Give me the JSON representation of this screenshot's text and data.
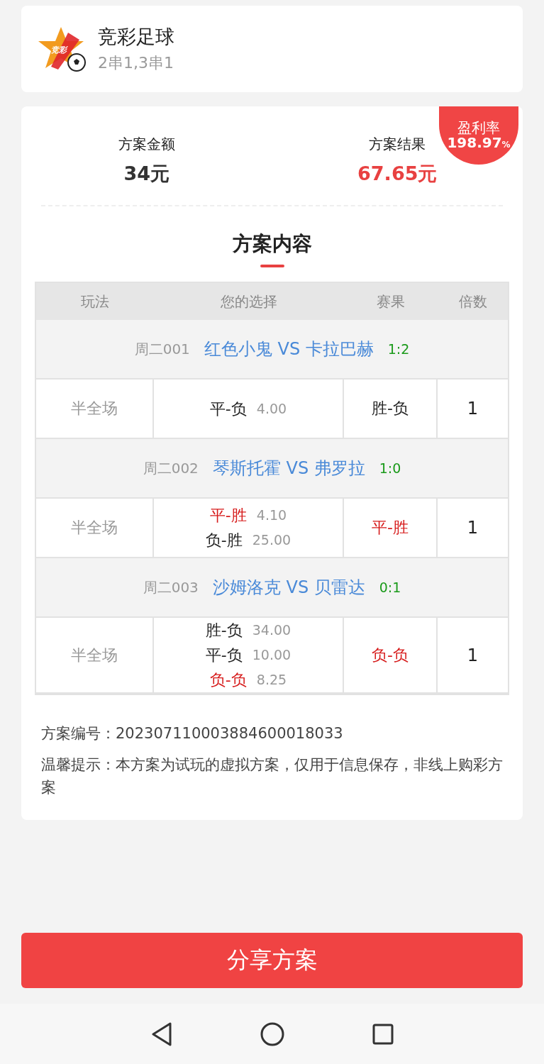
{
  "header": {
    "logo_text": "竞彩",
    "title": "竞彩足球",
    "subtitle": "2串1,3串1"
  },
  "summary": {
    "profit_badge": {
      "label": "盈利率",
      "value": "198.97",
      "unit": "%"
    },
    "items": [
      {
        "label": "方案金额",
        "value": "34元",
        "kind": "plain"
      },
      {
        "label": "方案结果",
        "value": "67.65元",
        "kind": "highlight"
      }
    ]
  },
  "section_title": "方案内容",
  "table": {
    "columns": [
      "玩法",
      "您的选择",
      "赛果",
      "倍数"
    ],
    "matches": [
      {
        "code": "周二001",
        "teams": "红色小鬼 VS 卡拉巴赫",
        "score": "1:2",
        "play": "半全场",
        "picks": [
          {
            "option": "平-负",
            "odds": "4.00",
            "hit": false
          }
        ],
        "result": {
          "text": "胜-负",
          "hit": false
        },
        "multiple": "1"
      },
      {
        "code": "周二002",
        "teams": "琴斯托霍 VS 弗罗拉",
        "score": "1:0",
        "play": "半全场",
        "picks": [
          {
            "option": "平-胜",
            "odds": "4.10",
            "hit": true
          },
          {
            "option": "负-胜",
            "odds": "25.00",
            "hit": false
          }
        ],
        "result": {
          "text": "平-胜",
          "hit": true
        },
        "multiple": "1"
      },
      {
        "code": "周二003",
        "teams": "沙姆洛克 VS 贝雷达",
        "score": "0:1",
        "play": "半全场",
        "picks": [
          {
            "option": "胜-负",
            "odds": "34.00",
            "hit": false
          },
          {
            "option": "平-负",
            "odds": "10.00",
            "hit": false
          },
          {
            "option": "负-负",
            "odds": "8.25",
            "hit": true
          }
        ],
        "result": {
          "text": "负-负",
          "hit": true
        },
        "multiple": "1"
      }
    ]
  },
  "plan_number": "方案编号：202307110003884600018033",
  "notice": "温馨提示：本方案为试玩的虚拟方案，仅用于信息保存，非线上购彩方案",
  "share_button": "分享方案"
}
